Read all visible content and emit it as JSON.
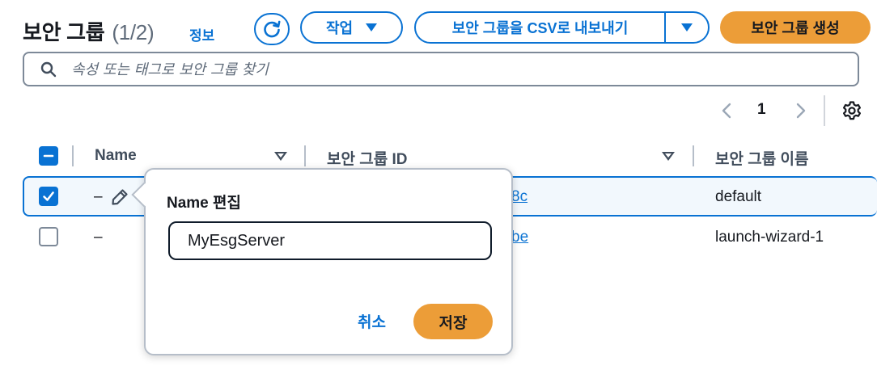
{
  "header": {
    "title": "보안 그룹",
    "count": "(1/2)",
    "info": "정보",
    "actions_label": "작업",
    "export_label": "보안 그룹을 CSV로 내보내기",
    "create_label": "보안 그룹 생성"
  },
  "search": {
    "placeholder": "속성 또는 태그로 보안 그룹 찾기"
  },
  "pagination": {
    "current_page": "1"
  },
  "table": {
    "columns": [
      "Name",
      "보안 그룹 ID",
      "보안 그룹 이름"
    ],
    "rows": [
      {
        "name": "–",
        "group_id": "8c",
        "group_name": "default",
        "selected": true
      },
      {
        "name": "–",
        "group_id": "be",
        "group_name": "launch-wizard-1",
        "selected": false
      }
    ]
  },
  "popover": {
    "title": "Name 편집",
    "input_value": "MyEsgServer",
    "cancel_label": "취소",
    "save_label": "저장"
  },
  "colors": {
    "primary": "#0972d3",
    "accent": "#ec9d38",
    "text": "#16191f"
  }
}
